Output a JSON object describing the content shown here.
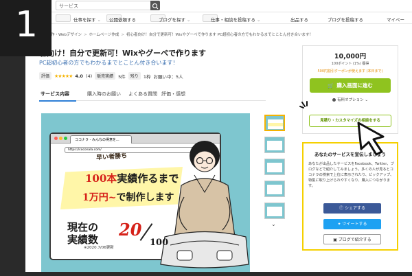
{
  "step": "1",
  "header": {
    "search_placeholder": "サービス"
  },
  "nav": {
    "items": [
      {
        "label": "仕事を探す"
      },
      {
        "label": "公開依頼する"
      },
      {
        "label": "ブログを探す"
      },
      {
        "label": "仕事・相談を投稿する"
      },
      {
        "label": "出品する"
      },
      {
        "label": "ブログを投稿する"
      },
      {
        "label": "マイペー"
      }
    ]
  },
  "breadcrumb": [
    "Webサイト制作・Webデザイン",
    "ホームページ作成",
    "初心者向け！自分で更新可！Wixやグーペで作ります PC超初心者の方でもわかるまでとことん付き合います！"
  ],
  "service": {
    "title": "者向け！自分で更新可！Wixやグーペで作ります",
    "subtitle": "PC超初心者の方でもわかるまでとことん付き合います！",
    "rating_label": "評価",
    "stars": "★★★★★",
    "rating_value": "4.0",
    "rating_count": "(4)",
    "sales_label": "販売実績",
    "sales_value": "5件",
    "remaining_label": "残り",
    "remaining_value": "1枠",
    "requests_label": "お願い中：5人"
  },
  "tabs": [
    "サービス内容",
    "購入時のお願い",
    "よくある質問",
    "評価・感想"
  ],
  "hero": {
    "tab_text": "ココナラ - みんなの得意を...",
    "address": "https://coconala.com/",
    "ribbon": "早い者勝ち",
    "line1_red": "100本",
    "line1_rest": "実績作るまで",
    "line2_red": "1万円~",
    "line2_rest": "で制作します",
    "record_label_1": "現在の",
    "record_label_2": "実績数",
    "record_num": "20",
    "record_total": "100",
    "record_date": "※2020.7/06更新"
  },
  "buybox": {
    "price": "10,000円",
    "points": "100ポイント (1%) 獲得",
    "coupon": "500円割引クーポンが使えます (本日まで)",
    "buy_label": "購入画面に進む",
    "option_label": "有料オプション",
    "custom_label": "見積り・カスタマイズの相談をする"
  },
  "share": {
    "title": "あなたのサービスを宣伝しましょう",
    "description": "あなたが出品したサービスをFacebook、Twitter、ブログなどで紹介してみましょう。多くの人が見るとココナラの検索で上位に表示されたり、ピックアップ、特集に取り上げられやすくなり、購入につながります。",
    "facebook_label": "シェアする",
    "twitter_label": "ツイートする",
    "blog_label": "ブログで紹介する"
  }
}
